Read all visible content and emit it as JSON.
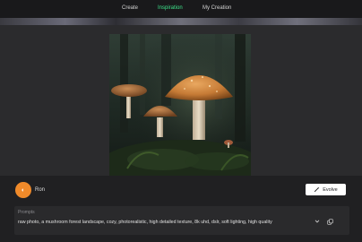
{
  "nav": {
    "tabs": [
      {
        "label": "Create",
        "active": false
      },
      {
        "label": "Inspiration",
        "active": true
      },
      {
        "label": "My Creation",
        "active": false
      }
    ]
  },
  "image": {
    "subject": "mushroom forest landscape"
  },
  "author": {
    "name": "Ron",
    "avatar_color": "#f08a2a"
  },
  "actions": {
    "evolve_label": "Evolve",
    "evolve_icon": "wand-icon"
  },
  "prompt": {
    "title": "Prompts",
    "text": "raw photo, a mushroom forest landscape, cozy, photorealistic, high detailed texture, 8k uhd, dslr, soft lighting, high quality",
    "expand_icon": "chevron-down-icon",
    "copy_icon": "copy-icon"
  },
  "colors": {
    "accent": "#3ee58c",
    "background": "#1b1b1d",
    "panel": "#2a2a2c"
  }
}
